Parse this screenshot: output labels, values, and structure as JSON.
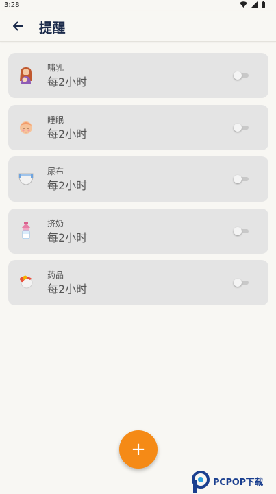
{
  "status_bar": {
    "time": "3:28",
    "icons": [
      "wifi-icon",
      "signal-icon",
      "battery-icon"
    ]
  },
  "header": {
    "title": "提醒",
    "back_icon": "arrow-back-icon"
  },
  "reminders": [
    {
      "name": "哺乳",
      "interval": "每2小时",
      "icon": "breastfeeding-icon",
      "enabled": false
    },
    {
      "name": "睡眠",
      "interval": "每2小时",
      "icon": "sleeping-baby-icon",
      "enabled": false
    },
    {
      "name": "尿布",
      "interval": "每2小时",
      "icon": "diaper-icon",
      "enabled": false
    },
    {
      "name": "挤奶",
      "interval": "每2小时",
      "icon": "breast-pump-bottle-icon",
      "enabled": false
    },
    {
      "name": "药品",
      "interval": "每2小时",
      "icon": "medicine-icon",
      "enabled": false
    }
  ],
  "fab": {
    "label": "+",
    "icon": "plus-icon"
  },
  "watermark": {
    "text": "PCPOP下载"
  },
  "colors": {
    "accent": "#f58a16",
    "card_bg": "#e4e4e4",
    "page_bg": "#f8f7f3",
    "title": "#1b2a4a"
  }
}
